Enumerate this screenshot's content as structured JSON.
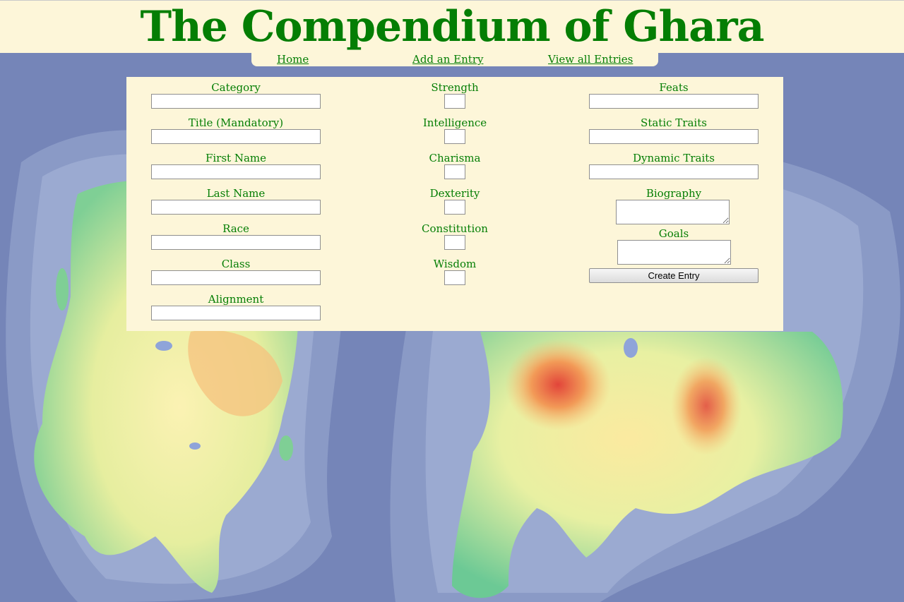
{
  "site": {
    "title": "The Compendium of Ghara"
  },
  "nav": {
    "home": "Home",
    "add": "Add an Entry",
    "view": "View all Entries"
  },
  "form": {
    "col1": [
      "Category",
      "Title (Mandatory)",
      "First Name",
      "Last Name",
      "Race",
      "Class",
      "Alignment"
    ],
    "col2": [
      "Strength",
      "Intelligence",
      "Charisma",
      "Dexterity",
      "Constitution",
      "Wisdom"
    ],
    "col3": [
      "Feats",
      "Static Traits",
      "Dynamic Traits",
      "Biography",
      "Goals"
    ],
    "submit_label": "Create Entry"
  },
  "colors": {
    "title_green": "#047e04",
    "panel_bg": "#fdf6d9",
    "ocean": "#7c8cbd"
  },
  "background": "fantasy world map with two islands"
}
